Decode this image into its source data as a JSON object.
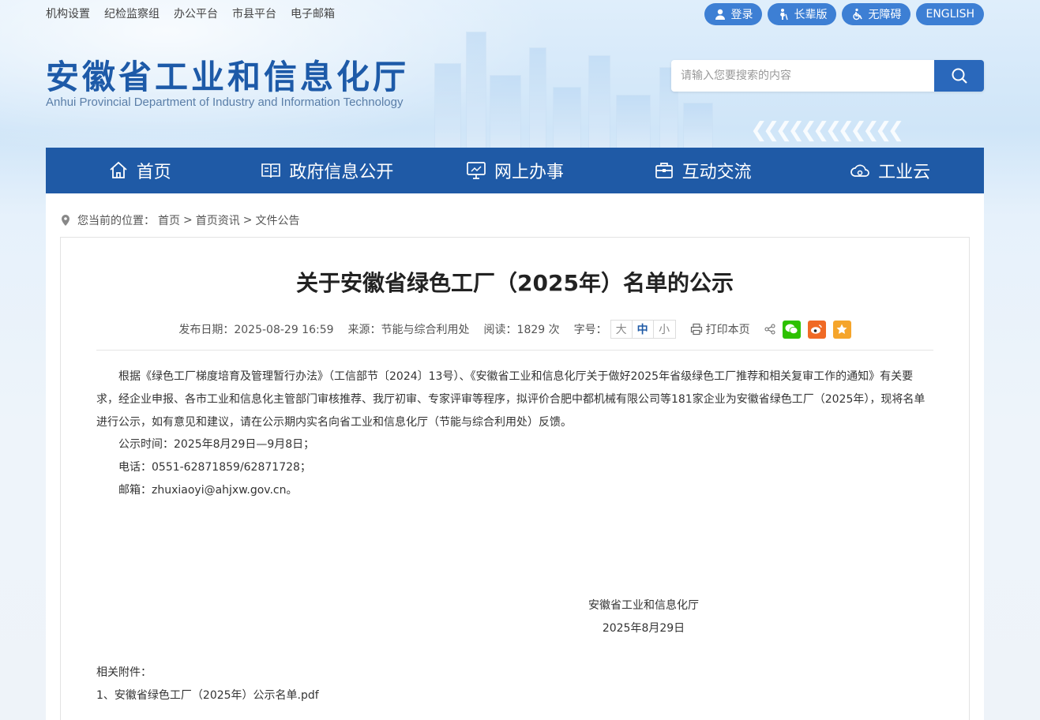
{
  "top_links": [
    "机构设置",
    "纪检监察组",
    "办公平台",
    "市县平台",
    "电子邮箱"
  ],
  "top_buttons": {
    "login": "登录",
    "elder": "长辈版",
    "access": "无障碍",
    "english": "ENGLISH"
  },
  "logo": {
    "cn": "安徽省工业和信息化厅",
    "en": "Anhui Provincial Department of Industry and Information Technology"
  },
  "search": {
    "placeholder": "请输入您要搜索的内容"
  },
  "nav": [
    "首页",
    "政府信息公开",
    "网上办事",
    "互动交流",
    "工业云"
  ],
  "breadcrumb": {
    "prefix": "您当前的位置：",
    "items": [
      "首页",
      "首页资讯",
      "文件公告"
    ],
    "sep": ">"
  },
  "article": {
    "title": "关于安徽省绿色工厂（2025年）名单的公示",
    "date": "发布日期：2025-08-29 16:59",
    "source": "来源：节能与综合利用处",
    "reads": "阅读：1829 次",
    "font_label": "字号：",
    "font_sizes": [
      "大",
      "中",
      "小"
    ],
    "print": "打印本页",
    "paragraphs": [
      "根据《绿色工厂梯度培育及管理暂行办法》（工信部节〔2024〕13号）、《安徽省工业和信息化厅关于做好2025年省级绿色工厂推荐和相关复审工作的通知》有关要求，经企业申报、各市工业和信息化主管部门审核推荐、我厅初审、专家评审等程序，拟评价合肥中都机械有限公司等181家企业为安徽省绿色工厂（2025年），现将名单进行公示，如有意见和建议，请在公示期内实名向省工业和信息化厅（节能与综合利用处）反馈。",
      "公示时间：2025年8月29日—9月8日；",
      "电话：0551-62871859/62871728；",
      "邮箱：zhuxiaoyi@ahjxw.gov.cn。"
    ],
    "sign_org": "安徽省工业和信息化厅",
    "sign_date": "2025年8月29日",
    "attach_label": "相关附件：",
    "attach_items": [
      "1、安徽省绿色工厂（2025年）公示名单.pdf"
    ]
  },
  "colors": {
    "nav": "#1f5aa6",
    "pill": "#3d7fd4",
    "wechat": "#2dc100",
    "weibo": "#f06a25",
    "fav": "#f5a52b"
  }
}
